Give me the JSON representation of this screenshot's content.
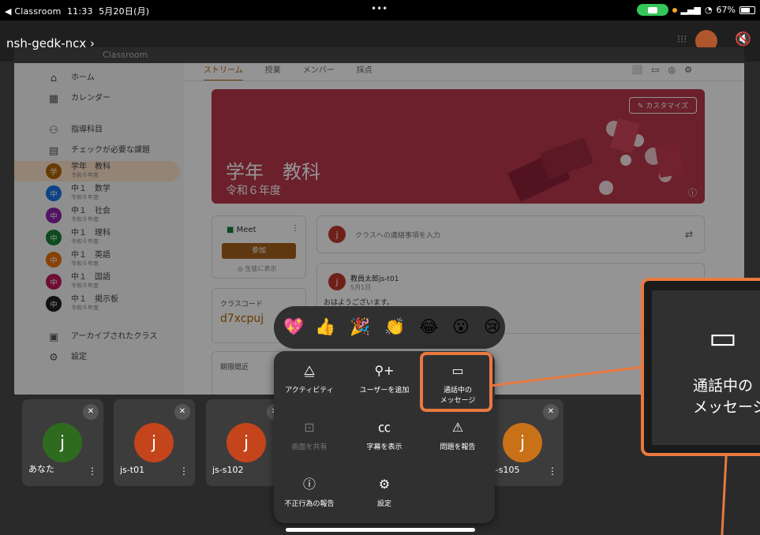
{
  "status_bar": {
    "back_app": "◀ Classroom",
    "time": "11:33",
    "date": "5月20日(月)",
    "dots": "•••",
    "battery": "67%"
  },
  "call": {
    "meeting_code": "nsh-gedk-ncx",
    "chevron": "›"
  },
  "classroom": {
    "breadcrumb": "Classroom",
    "tabs": [
      "ストリーム",
      "授業",
      "メンバー",
      "採点"
    ],
    "sidebar": [
      {
        "label": "ホーム",
        "icon": "home-icon"
      },
      {
        "label": "カレンダー",
        "icon": "calendar-icon"
      },
      {
        "label": "指導科目",
        "icon": "people-icon"
      },
      {
        "label": "チェックが必要な課題",
        "icon": "folder-icon"
      },
      {
        "label": "学年　教科",
        "sub": "令和６年度",
        "initial": "学",
        "color": "#b26500",
        "active": true
      },
      {
        "label": "中１　数学",
        "sub": "令和６年度",
        "initial": "中",
        "color": "#1a73e8"
      },
      {
        "label": "中１　社会",
        "sub": "令和６年度",
        "initial": "中",
        "color": "#8e24aa"
      },
      {
        "label": "中１　理科",
        "sub": "令和６年度",
        "initial": "中",
        "color": "#188038"
      },
      {
        "label": "中１　英語",
        "sub": "令和６年度",
        "initial": "中",
        "color": "#e8710a"
      },
      {
        "label": "中１　国語",
        "sub": "令和６年度",
        "initial": "中",
        "color": "#c2185b"
      },
      {
        "label": "中１　掲示板",
        "sub": "令和６年度",
        "initial": "中",
        "color": "#202124"
      },
      {
        "label": "アーカイブされたクラス",
        "icon": "archive-icon"
      },
      {
        "label": "設定",
        "icon": "gear-icon"
      }
    ],
    "banner": {
      "title": "学年　教科",
      "subtitle": "令和６年度",
      "customize": "カスタマイズ",
      "color": "#b9374a"
    },
    "meet": {
      "label": "Meet",
      "join": "参加",
      "show": "生徒に表示"
    },
    "class_code_label": "クラスコード",
    "class_code": "d7xcpuj",
    "due_label": "期限間近",
    "announce_placeholder": "クラスへの連絡事項を入力",
    "post": {
      "author": "教員太郎js-t01",
      "date": "5月1日",
      "body": "おはようございます。"
    }
  },
  "tiles": [
    {
      "name": "あなた",
      "initial": "j",
      "color": "#2e6b1f"
    },
    {
      "name": "js-t01",
      "initial": "j",
      "color": "#c4441b"
    },
    {
      "name": "js-s102",
      "initial": "j",
      "color": "#c4441b"
    },
    {
      "name": "js-s105",
      "initial": "j",
      "color": "#c97118"
    }
  ],
  "reactions": [
    "💖",
    "👍",
    "🎉",
    "👏",
    "😂",
    "😮",
    "😢"
  ],
  "menu": {
    "activity": "アクティビティ",
    "add_user": "ユーザーを追加",
    "chat_line1": "通話中の",
    "chat_line2": "メッセージ",
    "share_screen": "画面を共有",
    "captions": "字幕を表示",
    "report_problem": "問題を報告",
    "report_abuse": "不正行為の報告",
    "settings": "設定"
  },
  "zoom": {
    "line1": "通話中の",
    "line2": "メッセージ"
  },
  "accent": "#e8793f"
}
